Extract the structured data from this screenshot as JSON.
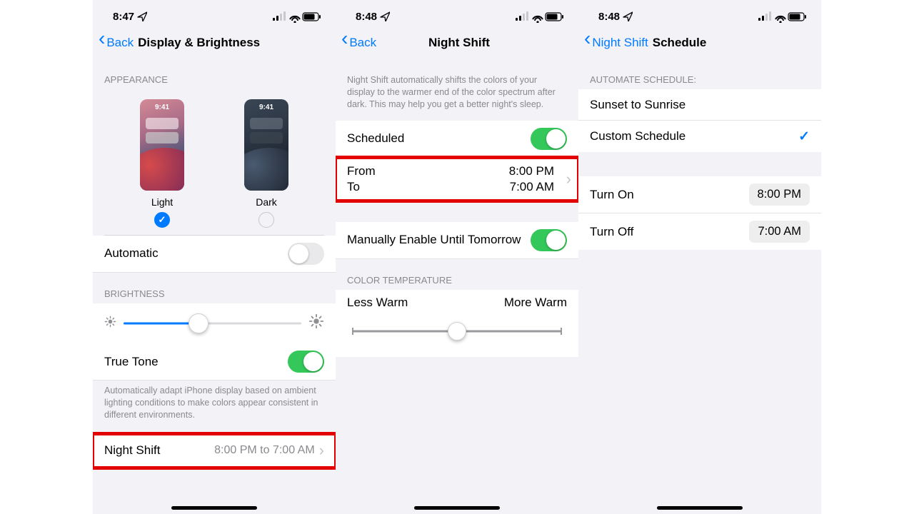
{
  "status": {
    "time1": "8:47",
    "time2": "8:48",
    "time3": "8:48"
  },
  "screen1": {
    "back": "Back",
    "title": "Display & Brightness",
    "appearance_header": "APPEARANCE",
    "thumb_time": "9:41",
    "light_label": "Light",
    "dark_label": "Dark",
    "automatic_label": "Automatic",
    "automatic_on": false,
    "brightness_header": "BRIGHTNESS",
    "brightness_pct": 42,
    "true_tone_label": "True Tone",
    "true_tone_on": true,
    "true_tone_footer": "Automatically adapt iPhone display based on ambient lighting conditions to make colors appear consistent in different environments.",
    "night_shift_label": "Night Shift",
    "night_shift_detail": "8:00 PM to 7:00 AM"
  },
  "screen2": {
    "back": "Back",
    "title": "Night Shift",
    "intro": "Night Shift automatically shifts the colors of your display to the warmer end of the color spectrum after dark. This may help you get a better night's sleep.",
    "scheduled_label": "Scheduled",
    "scheduled_on": true,
    "from_label": "From",
    "from_value": "8:00 PM",
    "to_label": "To",
    "to_value": "7:00 AM",
    "manual_label": "Manually Enable Until Tomorrow",
    "manual_on": true,
    "temp_header": "COLOR TEMPERATURE",
    "less_warm": "Less Warm",
    "more_warm": "More Warm",
    "temp_pct": 50
  },
  "screen3": {
    "back": "Night Shift",
    "title": "Schedule",
    "auto_header": "AUTOMATE SCHEDULE:",
    "opt_sunset": "Sunset to Sunrise",
    "opt_custom": "Custom Schedule",
    "selected": "custom",
    "turn_on_label": "Turn On",
    "turn_on_value": "8:00 PM",
    "turn_off_label": "Turn Off",
    "turn_off_value": "7:00 AM"
  }
}
